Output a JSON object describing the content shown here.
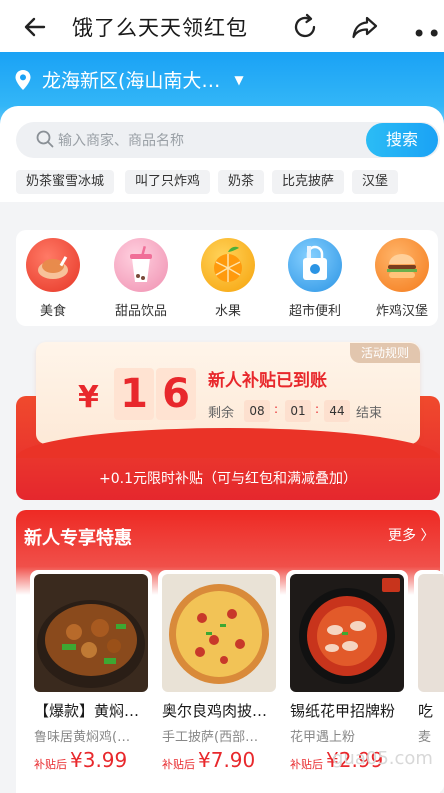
{
  "header": {
    "title": "饿了么天天领红包",
    "more": "•••"
  },
  "location": {
    "text": "龙海新区(海山南大…",
    "caret": "▼"
  },
  "search": {
    "placeholder": "输入商家、商品名称",
    "button": "搜索"
  },
  "hot_tags": [
    "奶茶蜜雪冰城",
    "叫了只炸鸡",
    "奶茶",
    "比克披萨",
    "汉堡"
  ],
  "categories": [
    {
      "label": "美食",
      "color": "#ef4b3b"
    },
    {
      "label": "甜品饮品",
      "color": "#f5a6c0"
    },
    {
      "label": "水果",
      "color": "#fbb11d"
    },
    {
      "label": "超市便利",
      "color": "#3da8ee"
    },
    {
      "label": "炸鸡汉堡",
      "color": "#f98a2c"
    }
  ],
  "coupon": {
    "rule": "活动规则",
    "yen": "¥",
    "digits": [
      "1",
      "6"
    ],
    "title": "新人补贴已到账",
    "remain_label": "剩余",
    "time": [
      "08",
      "01",
      "44"
    ],
    "end_label": "结束",
    "subsidy": "+0.1元限时补贴（可与红包和满减叠加）"
  },
  "deals": {
    "title": "新人专享特惠",
    "more": "更多 〉",
    "items": [
      {
        "name": "【爆款】黄焖…",
        "shop": "鲁味居黄焖鸡(…",
        "price_label": "补贴后",
        "price": "¥3.99"
      },
      {
        "name": "奥尔良鸡肉披…",
        "shop": "手工披萨(西部…",
        "price_label": "补贴后",
        "price": "¥7.90"
      },
      {
        "name": "锡纸花甲招牌粉",
        "shop": "花甲遇上粉",
        "price_label": "补贴后",
        "price": "¥2.99"
      }
    ],
    "partial_item": {
      "name": "吃",
      "shop": "麦"
    }
  },
  "watermark": "gua05.com",
  "colors": {
    "brand_blue": "#1aa2f5",
    "red": "#e8282c"
  }
}
